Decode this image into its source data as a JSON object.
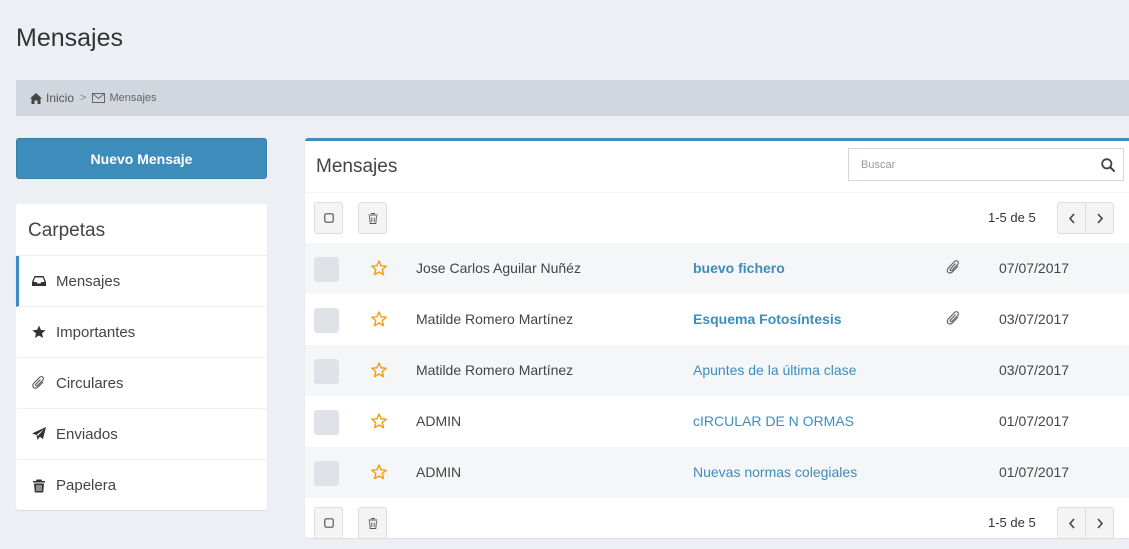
{
  "page": {
    "title": "Mensajes"
  },
  "breadcrumb": {
    "home": "Inicio",
    "separator": ">",
    "current": "Mensajes"
  },
  "sidebar": {
    "new_button": "Nuevo Mensaje",
    "folders_title": "Carpetas",
    "items": [
      {
        "label": "Mensajes",
        "icon": "inbox-icon",
        "active": true
      },
      {
        "label": "Importantes",
        "icon": "star-icon",
        "active": false
      },
      {
        "label": "Circulares",
        "icon": "paperclip-icon",
        "active": false
      },
      {
        "label": "Enviados",
        "icon": "paper-plane-icon",
        "active": false
      },
      {
        "label": "Papelera",
        "icon": "trash-icon",
        "active": false
      }
    ]
  },
  "mailbox": {
    "title": "Mensajes",
    "search_placeholder": "Buscar",
    "pager_text": "1-5 de 5",
    "messages": [
      {
        "from": "Jose Carlos Aguilar Nuñéz",
        "subject": "buevo fichero",
        "bold": true,
        "attachment": true,
        "date": "07/07/2017"
      },
      {
        "from": "Matilde Romero Martínez",
        "subject": "Esquema Fotosíntesis",
        "bold": true,
        "attachment": true,
        "date": "03/07/2017"
      },
      {
        "from": "Matilde Romero Martínez",
        "subject": "Apuntes de la última clase",
        "bold": false,
        "attachment": false,
        "date": "03/07/2017"
      },
      {
        "from": "ADMIN",
        "subject": "cIRCULAR DE N ORMAS",
        "bold": false,
        "attachment": false,
        "date": "01/07/2017"
      },
      {
        "from": "ADMIN",
        "subject": "Nuevas normas colegiales",
        "bold": false,
        "attachment": false,
        "date": "01/07/2017"
      }
    ]
  },
  "colors": {
    "accent": "#3c8dbc",
    "star": "#f39c12",
    "background": "#ecf0f5",
    "breadcrumb_bg": "#d2d6de"
  }
}
